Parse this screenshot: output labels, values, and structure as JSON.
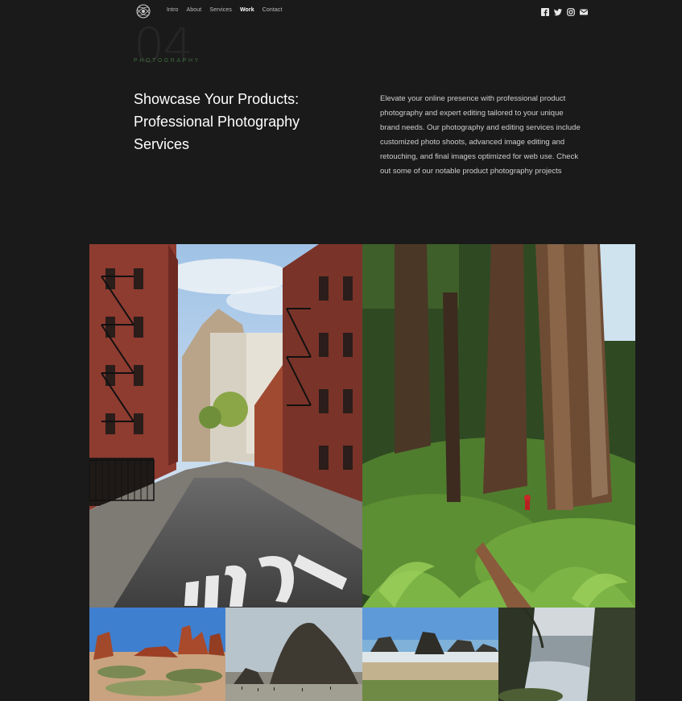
{
  "nav": {
    "links": [
      {
        "label": "Intro"
      },
      {
        "label": "About"
      },
      {
        "label": "Services"
      },
      {
        "label": "Work"
      },
      {
        "label": "Contact"
      }
    ],
    "active": "Work",
    "socials": [
      "facebook-icon",
      "twitter-icon",
      "instagram-icon",
      "mail-icon"
    ]
  },
  "hero": {
    "number": "04",
    "eyebrow": "PHOTOGRAPHY",
    "title": "Showcase Your Products: Professional Photography Services",
    "description": "Elevate your online presence with professional product photography and expert editing tailored to your unique brand needs. Our photography and editing services include customized photo shoots, advanced image editing and retouching, and final images optimized for web use. Check out some of our notable product photography projects"
  },
  "gallery": {
    "items": [
      {
        "subject": "city-street"
      },
      {
        "subject": "redwood-forest"
      },
      {
        "subject": "desert-rock-formations"
      },
      {
        "subject": "haystack-rock-beach"
      },
      {
        "subject": "sea-stacks-beach"
      },
      {
        "subject": "coastal-cliffs"
      }
    ]
  },
  "colors": {
    "background": "#1a1a1a",
    "accent": "#3e6b3a",
    "text": "#ffffff"
  }
}
